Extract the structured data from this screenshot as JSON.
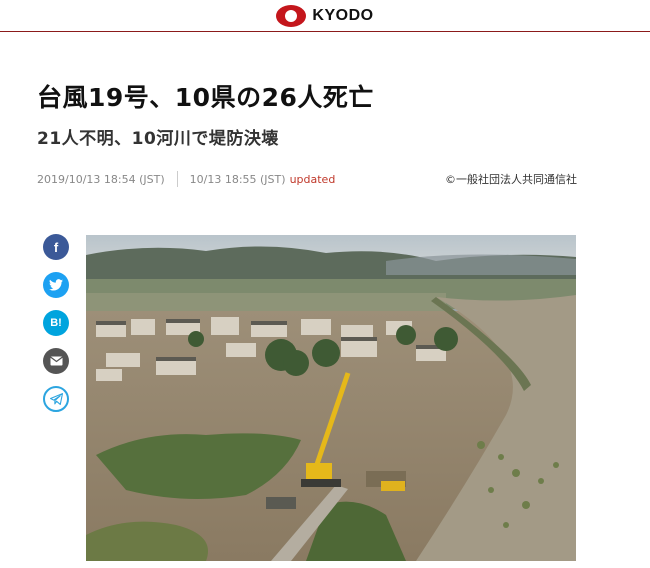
{
  "header": {
    "logo_text": "KYODO"
  },
  "article": {
    "title": "台風19号、10県の26人死亡",
    "subtitle": "21人不明、10河川で堤防決壊",
    "published": "2019/10/13 18:54 (JST)",
    "updated_time": "10/13 18:55 (JST)",
    "updated_label": "updated",
    "credit": "©一般社団法人共同通信社"
  },
  "share": {
    "facebook_glyph": "f",
    "twitter_glyph": "🐦",
    "hatena_glyph": "B!",
    "mail_glyph": "✉",
    "telegram_glyph": "➤"
  },
  "icons": [
    "kyodo-logo-icon",
    "facebook-icon",
    "twitter-icon",
    "hatena-bookmark-icon",
    "mail-icon",
    "telegram-icon"
  ],
  "colors": {
    "brand_red": "#c4161c",
    "header_rule": "#8b1a1a",
    "updated": "#c0392b",
    "facebook": "#3b5998",
    "twitter": "#1da1f2",
    "hatena": "#00a4de",
    "mail": "#555555",
    "telegram": "#2ca5e0"
  }
}
